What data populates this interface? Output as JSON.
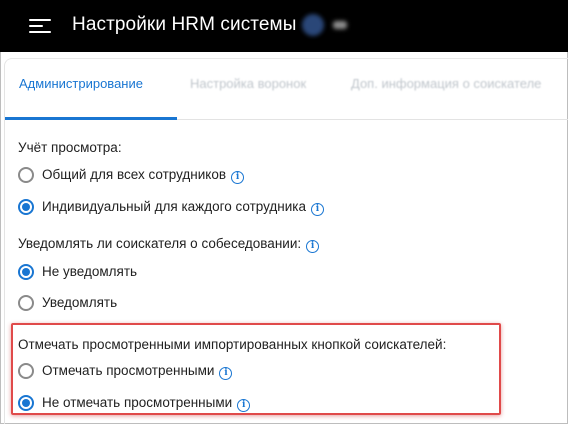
{
  "header": {
    "title": "Настройки HRM системы",
    "menu_icon": "menu-icon",
    "bg_color": "#000000"
  },
  "tabs": [
    {
      "label": "Администрирование",
      "active": true
    },
    {
      "label": "Настройка воронок",
      "active": false
    },
    {
      "label": "Доп. информация о соискателе",
      "active": false
    }
  ],
  "accent_color": "#1976d2",
  "settings": {
    "view_tracking": {
      "title": "Учёт просмотра:",
      "options": [
        {
          "label": "Общий для всех сотрудников",
          "checked": false
        },
        {
          "label": "Индивидуальный для каждого сотрудника",
          "checked": true
        }
      ]
    },
    "notify_candidate": {
      "title": "Уведомлять ли соискателя о собеседовании:",
      "options": [
        {
          "label": "Не уведомлять",
          "checked": true
        },
        {
          "label": "Уведомлять",
          "checked": false
        }
      ]
    },
    "mark_imported": {
      "title": "Отмечать просмотренными импортированных кнопкой соискателей:",
      "options": [
        {
          "label": "Отмечать просмотренными",
          "checked": false
        },
        {
          "label": "Не отмечать просмотренными",
          "checked": true
        }
      ],
      "highlight_color": "#e04a4a"
    }
  }
}
